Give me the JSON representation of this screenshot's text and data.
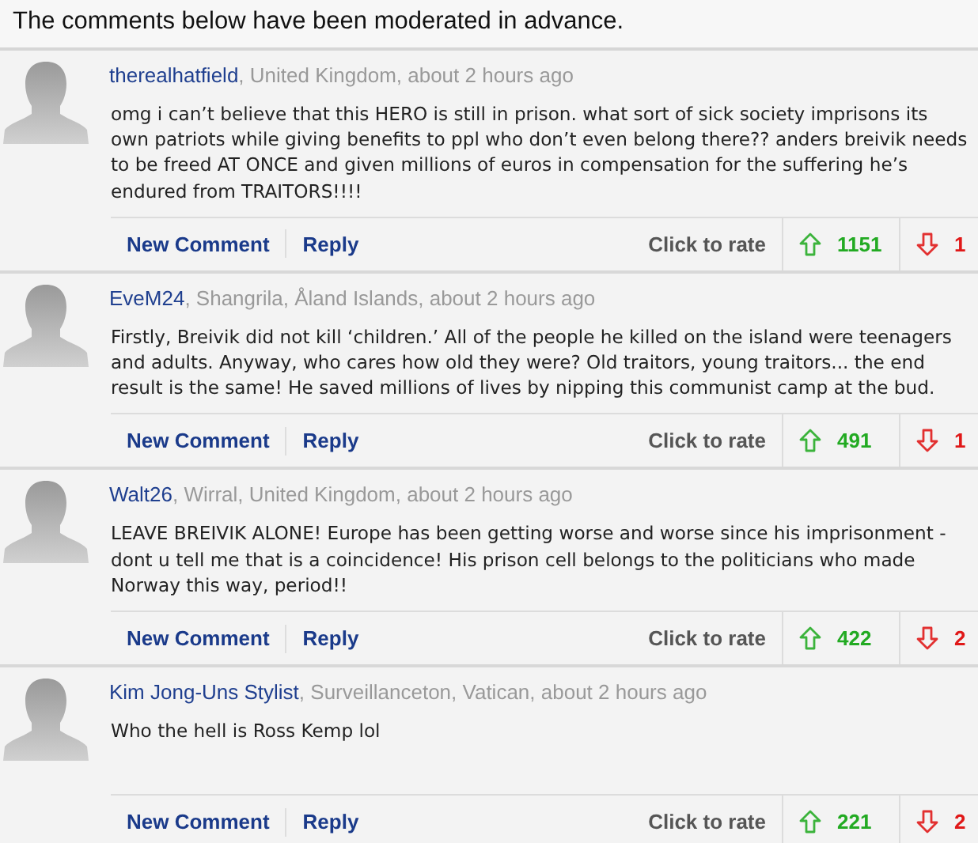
{
  "notice": "The comments below have been moderated in advance.",
  "comments": [
    {
      "author": "therealhatfield",
      "details": ", United Kingdom, about 2 hours ago",
      "text": "omg i can’t believe that this HERO is still in prison. what sort of sick society imprisons its own patriots while giving benefits to ppl who don’t even belong there?? anders breivik needs to be freed AT ONCE and given millions of euros in compensation for the suffering he’s endured from TRAITORS!!!!",
      "actions": [
        "New Comment",
        "Reply"
      ],
      "rate_label": "Click to rate",
      "up_votes": "1151",
      "down_votes": "1"
    },
    {
      "author": "EveM24",
      "details": ", Shangrila, Åland Islands, about 2 hours ago",
      "text": "Firstly, Breivik did not kill ‘children.’ All of the people he killed on the island were teenagers and adults. Anyway, who cares how old they were? Old traitors, young traitors... the end result is the same! He saved millions of lives by nipping this communist camp at the bud.",
      "actions": [
        "New Comment",
        "Reply"
      ],
      "rate_label": "Click to rate",
      "up_votes": "491",
      "down_votes": "1"
    },
    {
      "author": "Walt26",
      "details": ", Wirral, United Kingdom, about 2 hours ago",
      "text": "LEAVE BREIVIK ALONE! Europe has been getting worse and worse since his imprisonment - dont u tell me that is a coincidence! His prison cell belongs to the politicians who made Norway this way, period!!",
      "actions": [
        "New Comment",
        "Reply"
      ],
      "rate_label": "Click to rate",
      "up_votes": "422",
      "down_votes": "2"
    },
    {
      "author": "Kim Jong-Uns Stylist",
      "details": ", Surveillanceton, Vatican, about 2 hours ago",
      "text": "Who the hell is Ross Kemp lol",
      "actions": [
        "New Comment",
        "Reply"
      ],
      "rate_label": "Click to rate",
      "up_votes": "221",
      "down_votes": "2"
    }
  ]
}
